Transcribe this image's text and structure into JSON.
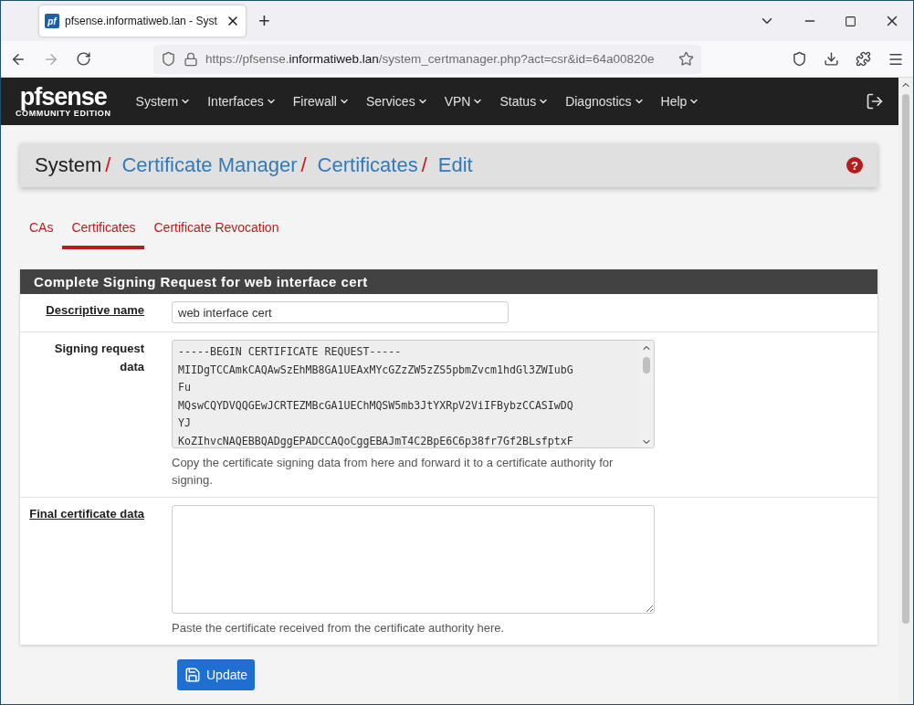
{
  "browser": {
    "favicon": "pf",
    "tab_title": "pfsense.informatiweb.lan - Syst",
    "new_tab": "+",
    "url": {
      "prefix": "https://pfsense.",
      "domain": "informatiweb.lan",
      "rest": "/system_certmanager.php?act=csr&id=64a00820e"
    }
  },
  "navbar": {
    "logo": "pfsense",
    "edition": "COMMUNITY EDITION",
    "menus": [
      "System",
      "Interfaces",
      "Firewall",
      "Services",
      "VPN",
      "Status",
      "Diagnostics",
      "Help"
    ]
  },
  "breadcrumb": [
    {
      "label": "System",
      "link": false
    },
    {
      "label": "Certificate Manager",
      "link": true
    },
    {
      "label": "Certificates",
      "link": true
    },
    {
      "label": "Edit",
      "link": true
    }
  ],
  "breadcrumb_separators": [
    "/",
    "/",
    "/"
  ],
  "help_button": "?",
  "tabs": [
    {
      "label": "CAs",
      "selected": false
    },
    {
      "label": "Certificates",
      "selected": true
    },
    {
      "label": "Certificate Revocation",
      "selected": false
    }
  ],
  "panel": {
    "title": "Complete Signing Request for web interface cert",
    "fields": [
      {
        "kind": "input",
        "label": "Descriptive name",
        "value": "web interface cert"
      },
      {
        "kind": "readonly_text",
        "label": "Signing request data",
        "lines": [
          "-----BEGIN CERTIFICATE REQUEST-----",
          "MIIDgTCCAmkCAQAwSzEhMB8GA1UEAxMYcGZzZW5zZS5pbmZvcm1hdGl3ZWIubG",
          "Fu",
          "MQswCQYDVQQGEwJCRTEZMBcGA1UEChMQSW5mb3JtYXRpV2ViIFBybzCCASIwDQ",
          "YJ",
          "KoZIhvcNAQEBBQADggEPADCCAQoCggEBAJmT4C2BpE6C6p38fr7Gf2BLsfptxF"
        ],
        "help": "Copy the certificate signing data from here and forward it to a certificate authority for signing."
      },
      {
        "kind": "textarea",
        "label": "Final certificate data",
        "help": "Paste the certificate received from the certificate authority here."
      }
    ]
  },
  "submit": "Update"
}
